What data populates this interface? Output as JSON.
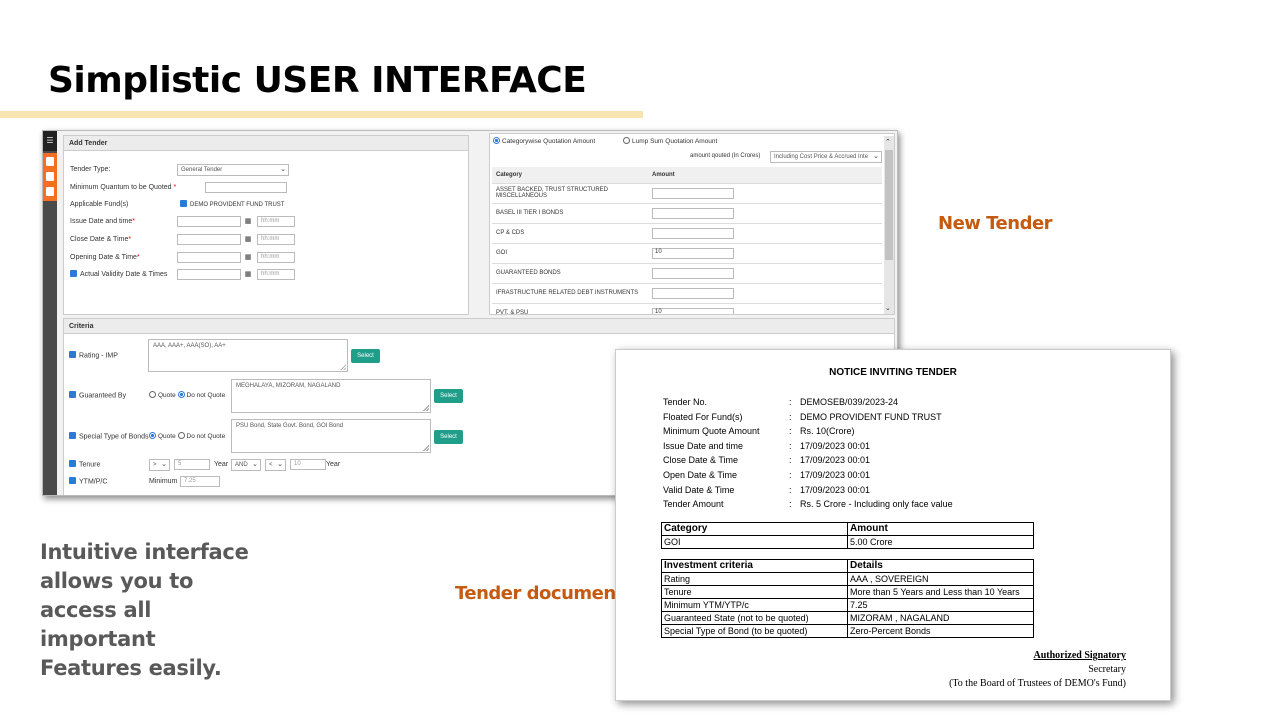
{
  "slide": {
    "title": "Simplistic USER INTERFACE",
    "callout_new_tender": "New Tender",
    "callout_tender_document": "Tender document",
    "side_text": "Intuitive interface allows you to access all important Features easily."
  },
  "colors": {
    "accent": "#c55a11",
    "title_bar": "#f7e4b0",
    "select_button": "#1f9e8a",
    "sidebar_orange": "#f36f21"
  },
  "app": {
    "sidebar": {
      "top_glyph": "☰"
    },
    "add_tender": {
      "header": "Add Tender",
      "tender_type_label": "Tender Type:",
      "tender_type_value": "General Tender",
      "min_quantum_label": "Minimum Quantum to be Quoted",
      "req": "*",
      "applicable_funds_label": "Applicable Fund(s)",
      "fund_option": "DEMO PROVIDENT FUND TRUST",
      "issue_label": "Issue Date and time",
      "close_label": "Close Date & Time",
      "opening_label": "Opening Date & Time",
      "validity_label": "Actual Validity Date & Times",
      "time_placeholder": "hh:mm"
    },
    "quotation": {
      "option_categorywise": "Categorywise Quotation Amount",
      "option_lumpsum": "Lump Sum Quotation Amount",
      "amount_quoted_label": "amount qouted (In Crores)",
      "amount_quoted_value": "Including Cost Price & Accrued Inte",
      "col_category": "Category",
      "col_amount": "Amount",
      "rows": [
        {
          "category": "ASSET BACKED, TRUST STRUCTURED MISCELLANEOUS",
          "amount": ""
        },
        {
          "category": "BASEL III TIER I BONDS",
          "amount": ""
        },
        {
          "category": "CP & CDS",
          "amount": ""
        },
        {
          "category": "GOI",
          "amount": "10"
        },
        {
          "category": "GUARANTEED BONDS",
          "amount": ""
        },
        {
          "category": "IFRASTRUCTURE RELATED DEBT INSTRUMENTS",
          "amount": ""
        },
        {
          "category": "PVT. & PSU",
          "amount": "10"
        }
      ]
    },
    "criteria": {
      "header": "Criteria",
      "rating_label": "Rating - IMP",
      "rating_value": "AAA, AAA+, AAA(SO), AA+",
      "guaranteed_label": "Guaranteed By",
      "guaranteed_value": "MEGHALAYA, MIZORAM, NAGALAND",
      "special_label": "Special Type of Bonds",
      "special_value": "PSU Bond, State Govt. Bond, GOI Bond",
      "quote": "Quote",
      "do_not_quote": "Do not Quote",
      "select": "Select",
      "tenure_label": "Tenure",
      "tenure_op1": ">",
      "tenure_val1": "5",
      "year": "Year",
      "and": "AND",
      "tenure_op2": "<",
      "tenure_val2": "10",
      "ytm_label": "YTM/P/C",
      "minimum_label": "Minimum",
      "ytm_value": "7.25"
    }
  },
  "doc": {
    "title": "NOTICE INVITING TENDER",
    "fields": [
      {
        "label": "Tender No.",
        "value": "DEMOSEB/039/2023-24"
      },
      {
        "label": "Floated For Fund(s)",
        "value": "DEMO PROVIDENT FUND TRUST"
      },
      {
        "label": "Minimum Quote Amount",
        "value": "Rs. 10(Crore)"
      },
      {
        "label": "Issue Date and time",
        "value": "17/09/2023 00:01"
      },
      {
        "label": "Close Date & Time",
        "value": "17/09/2023 00:01"
      },
      {
        "label": "Open Date & Time",
        "value": "17/09/2023 00:01"
      },
      {
        "label": "Valid Date & Time",
        "value": "17/09/2023 00:01"
      },
      {
        "label": "Tender Amount",
        "value": "Rs. 5 Crore - Including only face value"
      }
    ],
    "colon": ":",
    "category_table": {
      "headers": [
        "Category",
        "Amount"
      ],
      "rows": [
        [
          "GOI",
          "5.00 Crore"
        ]
      ]
    },
    "criteria_table": {
      "headers": [
        "Investment criteria",
        "Details"
      ],
      "rows": [
        [
          "Rating",
          "AAA , SOVEREIGN"
        ],
        [
          "Tenure",
          "More than 5 Years and Less than 10 Years"
        ],
        [
          "Minimum YTM/YTP/c",
          "7.25"
        ],
        [
          "Guaranteed State (not to be quoted)",
          "MIZORAM , NAGALAND"
        ],
        [
          "Special Type of Bond (to be quoted)",
          "Zero-Percent Bonds"
        ]
      ]
    },
    "signatory": "Authorized Signatory",
    "secretary": "Secretary",
    "board": "(To the Board of Trustees of DEMO's Fund)"
  }
}
